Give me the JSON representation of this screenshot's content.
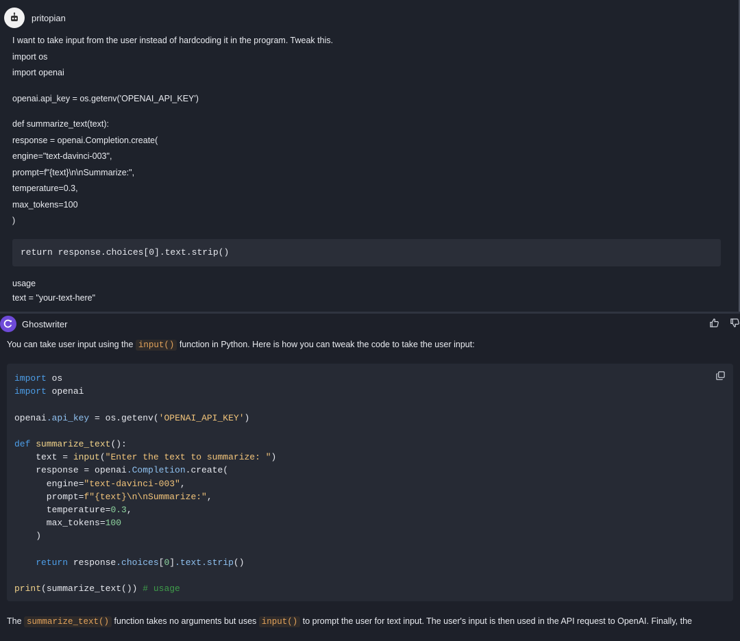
{
  "user_message": {
    "username": "pritopian",
    "lines": [
      "I want to take input from the user instead of hardcoding it in the program. Tweak this.",
      "import os",
      "import openai",
      "",
      "openai.api_key = os.getenv('OPENAI_API_KEY')",
      "",
      "def summarize_text(text):",
      "response = openai.Completion.create(",
      "engine=\"text-davinci-003\",",
      "prompt=f\"{text}\\n\\nSummarize:\",",
      "temperature=0.3,",
      "max_tokens=100",
      ")"
    ],
    "code_line": "return response.choices[0].text.strip()",
    "tail_lines": [
      "usage",
      "text = \"your-text-here\""
    ]
  },
  "bot_message": {
    "name": "Ghostwriter",
    "intro_before": "You can take user input using the ",
    "intro_code": "input()",
    "intro_after": " function in Python. Here is how you can tweak the code to take the user input:",
    "outro_before": "The ",
    "outro_code1": "summarize_text()",
    "outro_mid": " function takes no arguments but uses ",
    "outro_code2": "input()",
    "outro_after": " to prompt the user for text input. The user's input is then used in the API request to OpenAI. Finally, the"
  },
  "code": {
    "l1_kw": "import",
    "l1_rest": " os",
    "l2_kw": "import",
    "l2_rest": " openai",
    "l4_a": "openai",
    "l4_b": ".api_key",
    "l4_c": " = ",
    "l4_d": "os",
    "l4_e": ".getenv(",
    "l4_f": "'OPENAI_API_KEY'",
    "l4_g": ")",
    "l6_kw": "def",
    "l6_fn": " summarize_text",
    "l6_rest": "():",
    "l7_a": "    text = ",
    "l7_fn": "input",
    "l7_b": "(",
    "l7_str": "\"Enter the text to summarize: \"",
    "l7_c": ")",
    "l8_a": "    response = openai",
    "l8_b": ".Completion",
    "l8_c": ".create(",
    "l9_a": "      engine=",
    "l9_str": "\"text-davinci-003\"",
    "l9_b": ",",
    "l10_a": "      prompt=",
    "l10_str": "f\"{text}\\n\\nSummarize:\"",
    "l10_b": ",",
    "l11_a": "      temperature=",
    "l11_num": "0.3",
    "l11_b": ",",
    "l12_a": "      max_tokens=",
    "l12_num": "100",
    "l13": "    )",
    "l15_kw": "    return",
    "l15_a": " response",
    "l15_b": ".choices",
    "l15_c": "[",
    "l15_num": "0",
    "l15_d": "]",
    "l15_e": ".text",
    "l15_f": ".strip",
    "l15_g": "()",
    "l17_fn": "print",
    "l17_a": "(",
    "l17_fn2": "summarize_text",
    "l17_b": "())",
    "l17_cm": " # usage"
  },
  "colors": {
    "bot_accent": "#6e4ad8",
    "inline_code": "#e3a35b",
    "keyword": "#4d9ee8"
  },
  "icons": [
    "robot-avatar-icon",
    "ghostwriter-logo-icon",
    "thumbs-up-icon",
    "thumbs-down-icon",
    "copy-icon"
  ]
}
